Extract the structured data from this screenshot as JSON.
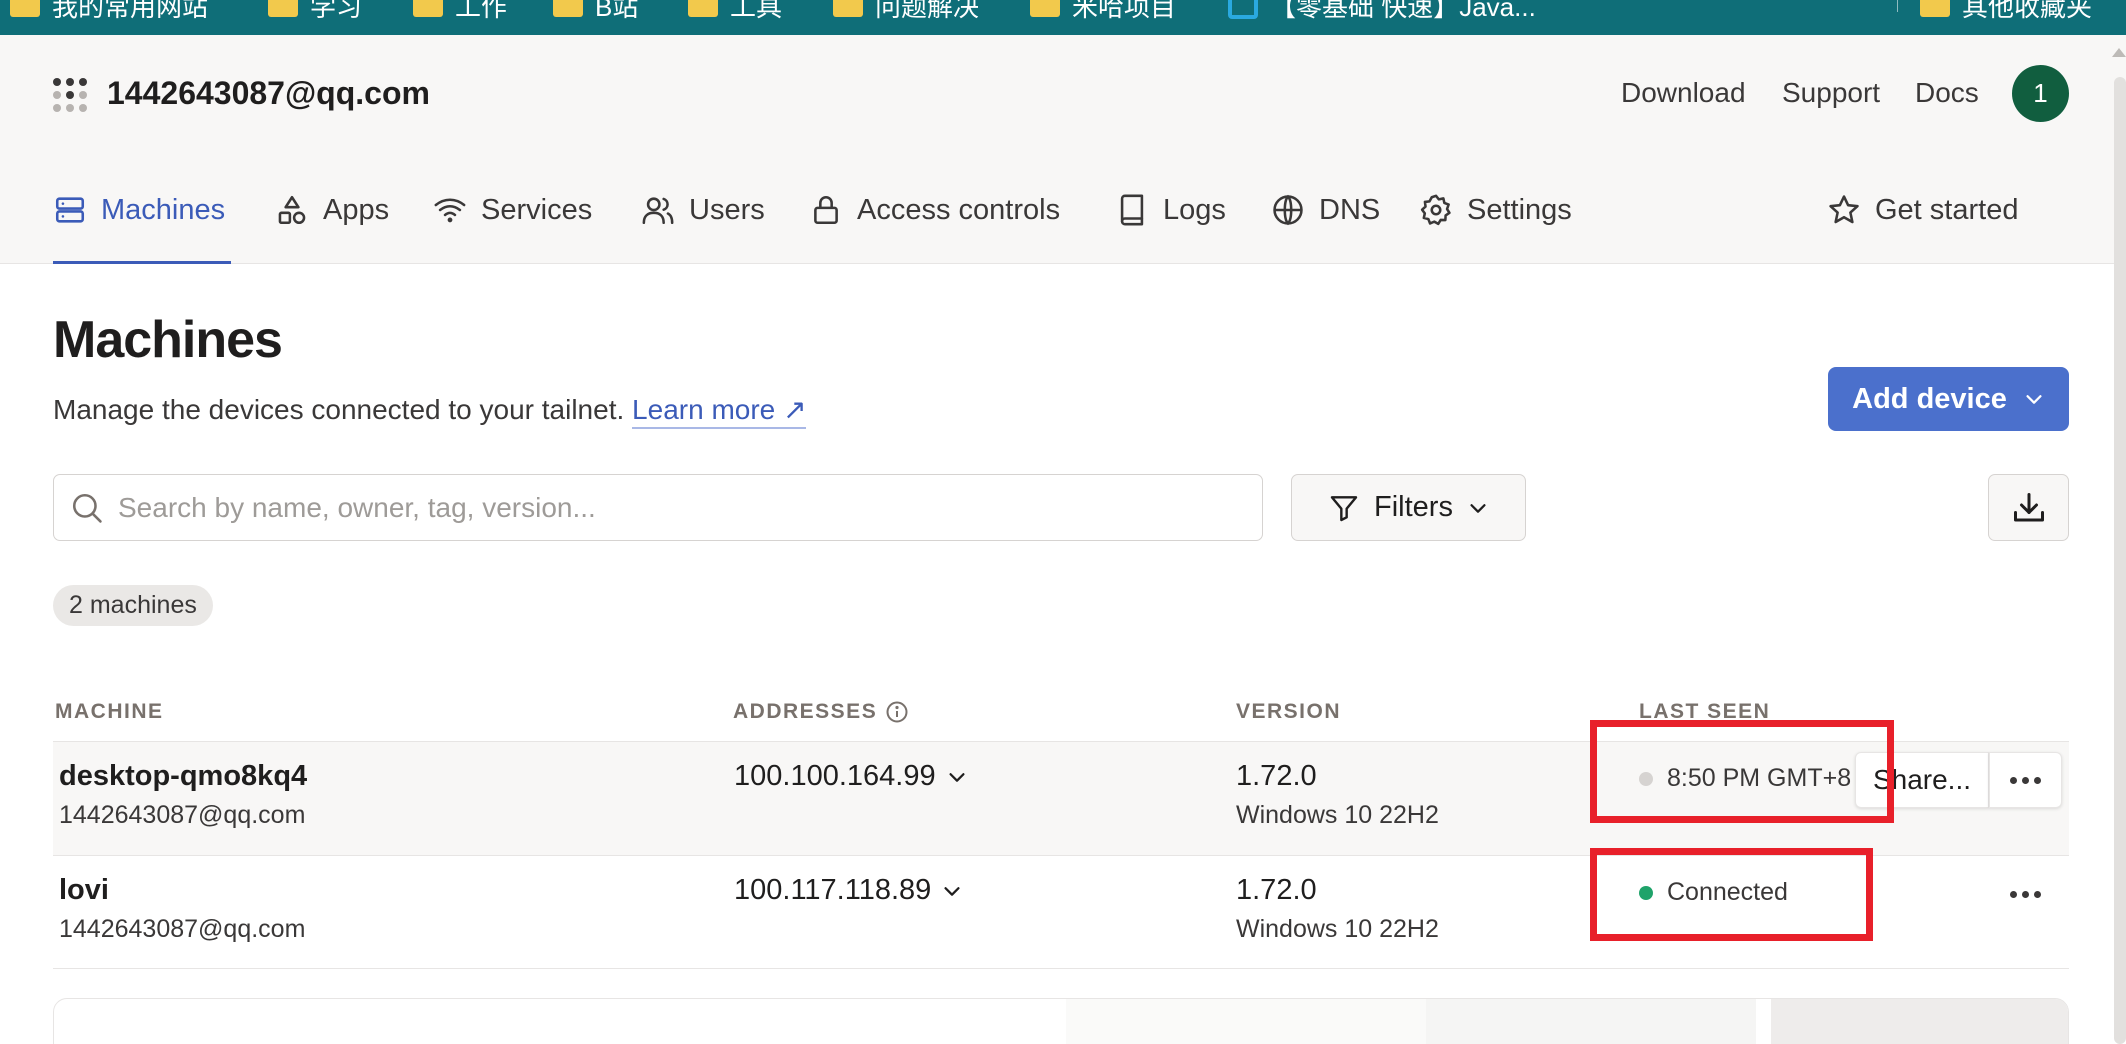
{
  "bookmarks": [
    {
      "label": "我的常用网站"
    },
    {
      "label": "学习"
    },
    {
      "label": "工作"
    },
    {
      "label": "B站"
    },
    {
      "label": "工具"
    },
    {
      "label": "问题解决"
    },
    {
      "label": "米哈项目"
    },
    {
      "label": "【零基础 快速】Java..."
    },
    {
      "label": "其他收藏夹"
    }
  ],
  "header": {
    "tailnet_name": "1442643087@qq.com",
    "links": {
      "download": "Download",
      "support": "Support",
      "docs": "Docs"
    },
    "avatar_initial": "1"
  },
  "nav": {
    "machines": "Machines",
    "apps": "Apps",
    "services": "Services",
    "users": "Users",
    "access_controls": "Access controls",
    "logs": "Logs",
    "dns": "DNS",
    "settings": "Settings",
    "get_started": "Get started",
    "active": "machines"
  },
  "main": {
    "title": "Machines",
    "subtitle": "Manage the devices connected to your tailnet.",
    "learn_more": "Learn more ↗",
    "add_device": "Add device",
    "search_placeholder": "Search by name, owner, tag, version...",
    "filters": "Filters",
    "machine_count": "2 machines"
  },
  "table": {
    "headers": {
      "machine": "MACHINE",
      "addresses": "ADDRESSES",
      "version": "VERSION",
      "last_seen": "LAST SEEN"
    },
    "rows": [
      {
        "name": "desktop-qmo8kq4",
        "owner": "1442643087@qq.com",
        "address": "100.100.164.99",
        "version": "1.72.0",
        "os": "Windows 10 22H2",
        "last_seen": "8:50 PM GMT+8",
        "status": "offline"
      },
      {
        "name": "lovi",
        "owner": "1442643087@qq.com",
        "address": "100.117.118.89",
        "version": "1.72.0",
        "os": "Windows 10 22H2",
        "last_seen": "Connected",
        "status": "connected"
      }
    ],
    "share_label": "Share..."
  },
  "colors": {
    "accent": "#3b5bb8",
    "primary_button": "#4b70cc",
    "connected_dot": "#1fa36a",
    "offline_dot": "#d6d3d1",
    "annotation": "#e8202a",
    "bookmarks_bar": "#0f6e78",
    "avatar": "#115e3f"
  }
}
